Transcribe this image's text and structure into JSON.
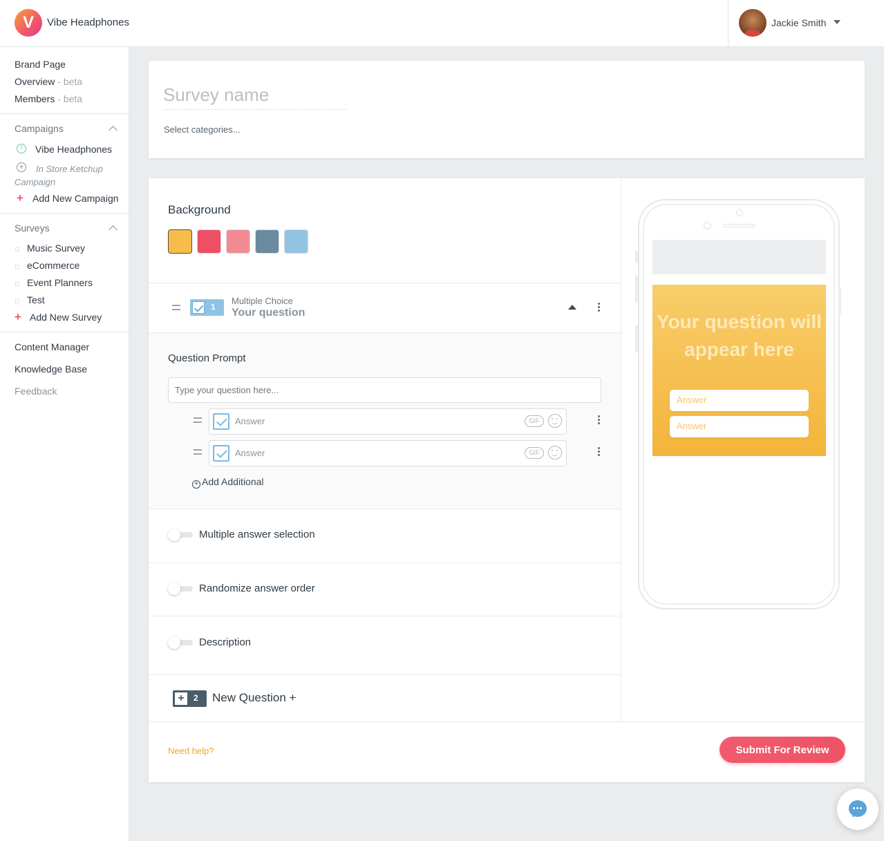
{
  "header": {
    "brand_name": "Vibe Headphones",
    "logo_letter": "V",
    "user_name": "Jackie Smith"
  },
  "sidebar": {
    "brand_page": "Brand Page",
    "overview": "Overview",
    "overview_tag": "- beta",
    "members": "Members",
    "members_tag": "- beta",
    "campaigns_title": "Campaigns",
    "campaigns": [
      {
        "label": "Vibe Headphones"
      },
      {
        "label": "In Store Ketchup Campaign"
      }
    ],
    "add_campaign": "Add New Campaign",
    "surveys_title": "Surveys",
    "surveys": [
      {
        "label": "Music Survey"
      },
      {
        "label": "eCommerce"
      },
      {
        "label": "Event Planners"
      },
      {
        "label": "Test"
      }
    ],
    "add_survey": "Add New Survey",
    "content_manager": "Content Manager",
    "knowledge_base": "Knowledge Base",
    "feedback": "Feedback"
  },
  "survey": {
    "name_placeholder": "Survey name",
    "categories_placeholder": "Select categories..."
  },
  "editor": {
    "background_title": "Background",
    "swatches": [
      "#f7bd4c",
      "#ee4f63",
      "#f28a93",
      "#6b8aa0",
      "#93c3e3"
    ],
    "question": {
      "number": "1",
      "type": "Multiple Choice",
      "title": "Your question"
    },
    "prompt_title": "Question Prompt",
    "prompt_placeholder": "Type your question here...",
    "answers": [
      {
        "placeholder": "Answer",
        "gif": "GIF"
      },
      {
        "placeholder": "Answer",
        "gif": "GIF"
      }
    ],
    "add_additional": "Add Additional",
    "toggles": [
      {
        "label": "Multiple answer selection"
      },
      {
        "label": "Randomize answer order"
      },
      {
        "label": "Description"
      }
    ],
    "new_question_number": "2",
    "new_question_label": "New Question +"
  },
  "preview": {
    "question_text": "Your question will appear here",
    "answers": [
      "Answer",
      "Answer"
    ]
  },
  "footer": {
    "need_help": "Need help?",
    "submit": "Submit For Review"
  },
  "colors": {
    "accent_red": "#f1566a",
    "accent_blue": "#8fc3e4",
    "accent_orange": "#f5a623"
  }
}
